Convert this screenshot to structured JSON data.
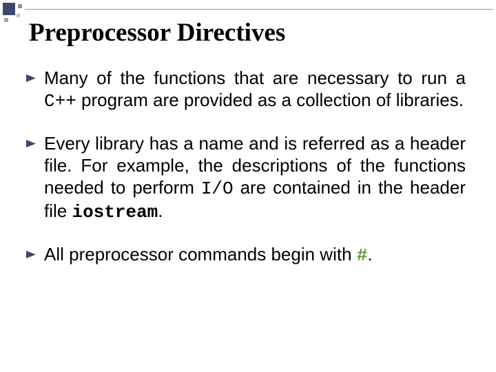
{
  "title": "Preprocessor Directives",
  "bullets": {
    "b1": {
      "t1": " Many of the functions that are necessary to run a ",
      "code1": "C++",
      "t2": " program are provided as a collection of libraries."
    },
    "b2": {
      "t1": " Every library has a name and is referred as a header file. For example, the descriptions of the functions needed to perform ",
      "code1": "I/O",
      "t2": " are contained in the header file ",
      "code2": "iostream",
      "t3": "."
    },
    "b3": {
      "t1": " All preprocessor commands begin with ",
      "hash": "#",
      "t2": "."
    }
  }
}
